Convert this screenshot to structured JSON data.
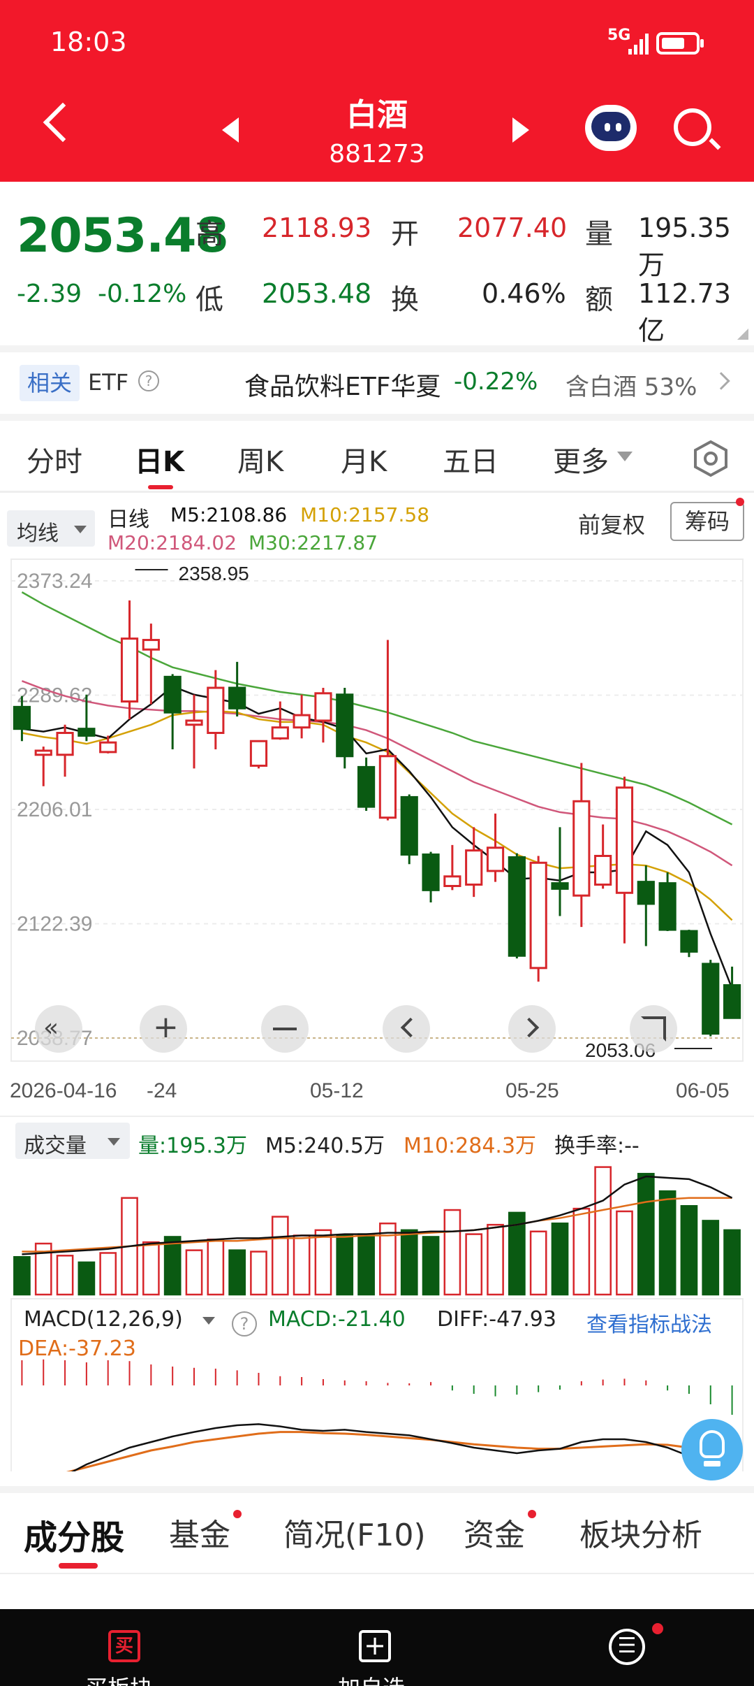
{
  "status_bar": {
    "time": "18:03",
    "network": "5G"
  },
  "header": {
    "title": "白酒",
    "code": "881273"
  },
  "quote": {
    "price": "2053.48",
    "change": "-2.39",
    "change_pct": "-0.12%",
    "high_label": "高",
    "high": "2118.93",
    "open_label": "开",
    "open": "2077.40",
    "volume_label": "量",
    "volume": "195.35万",
    "low_label": "低",
    "low": "2053.48",
    "turnover_label": "换",
    "turnover": "0.46%",
    "amount_label": "额",
    "amount": "112.73亿"
  },
  "etf": {
    "tag": "相关",
    "label": "ETF",
    "name": "食品饮料ETF华夏",
    "change": "-0.22%",
    "holding": "含白酒 53%"
  },
  "period_tabs": [
    "分时",
    "日K",
    "周K",
    "月K",
    "五日",
    "更多"
  ],
  "active_tab": "日K",
  "ma": {
    "selector": "均线",
    "line_label": "日线",
    "m5": "M5:2108.86",
    "m10": "M10:2157.58",
    "m20": "M20:2184.02",
    "m30": "M30:2217.87",
    "adjust": "前复权",
    "chips": "筹码"
  },
  "kline": {
    "y_ticks": [
      "2373.24",
      "2289.62",
      "2206.01",
      "2122.39",
      "2038.77"
    ],
    "max_label": "2358.95",
    "min_label": "2053.06",
    "x_labels": [
      "2026-04-16",
      "-24",
      "05-12",
      "05-25",
      "06-05"
    ]
  },
  "volume_panel": {
    "selector": "成交量",
    "vol": "量:195.3万",
    "m5": "M5:240.5万",
    "m10": "M10:284.3万",
    "turnover": "换手率:--"
  },
  "macd_panel": {
    "selector": "MACD(12,26,9)",
    "macd": "MACD:-21.40",
    "diff": "DIFF:-47.93",
    "link": "查看指标战法",
    "dea": "DEA:-37.23"
  },
  "bottom_tabs": [
    "成分股",
    "基金",
    "简况(F10)",
    "资金",
    "板块分析"
  ],
  "nav": [
    "买板块",
    "加自选",
    "更多"
  ],
  "colors": {
    "up": "#d7262b",
    "down": "#0a5a12",
    "brand": "#f2182a",
    "m5": "#111111",
    "m10": "#d4a106",
    "m20": "#d0577a",
    "m30": "#4aa63a"
  },
  "chart_data": {
    "type": "candlestick",
    "price_axis": [
      2038.77,
      2373.24
    ],
    "candles": [
      {
        "open": 2281,
        "close": 2265,
        "high": 2289,
        "low": 2256
      },
      {
        "open": 2246,
        "close": 2249,
        "high": 2252,
        "low": 2223
      },
      {
        "open": 2246,
        "close": 2262,
        "high": 2268,
        "low": 2230
      },
      {
        "open": 2265,
        "close": 2260,
        "high": 2290,
        "low": 2256
      },
      {
        "open": 2248,
        "close": 2255,
        "high": 2260,
        "low": 2247
      },
      {
        "open": 2285,
        "close": 2331,
        "high": 2358.95,
        "low": 2272
      },
      {
        "open": 2323,
        "close": 2330,
        "high": 2342,
        "low": 2283
      },
      {
        "open": 2303,
        "close": 2277,
        "high": 2305,
        "low": 2250
      },
      {
        "open": 2268,
        "close": 2271,
        "high": 2290,
        "low": 2236
      },
      {
        "open": 2262,
        "close": 2295,
        "high": 2308,
        "low": 2250
      },
      {
        "open": 2295,
        "close": 2280,
        "high": 2314,
        "low": 2274
      },
      {
        "open": 2238,
        "close": 2256,
        "high": 2256,
        "low": 2236
      },
      {
        "open": 2258,
        "close": 2266,
        "high": 2285,
        "low": 2257
      },
      {
        "open": 2266,
        "close": 2275,
        "high": 2290,
        "low": 2258
      },
      {
        "open": 2271,
        "close": 2291,
        "high": 2295,
        "low": 2255
      },
      {
        "open": 2290,
        "close": 2245,
        "high": 2295,
        "low": 2236
      },
      {
        "open": 2237,
        "close": 2208,
        "high": 2244,
        "low": 2205
      },
      {
        "open": 2200,
        "close": 2245,
        "high": 2330,
        "low": 2198
      },
      {
        "open": 2215,
        "close": 2173,
        "high": 2217,
        "low": 2166
      },
      {
        "open": 2173,
        "close": 2147,
        "high": 2175,
        "low": 2138
      },
      {
        "open": 2150,
        "close": 2157,
        "high": 2180,
        "low": 2147
      },
      {
        "open": 2151,
        "close": 2176,
        "high": 2193,
        "low": 2142
      },
      {
        "open": 2161,
        "close": 2178,
        "high": 2203,
        "low": 2153
      },
      {
        "open": 2171,
        "close": 2099,
        "high": 2174,
        "low": 2097
      },
      {
        "open": 2090,
        "close": 2167,
        "high": 2172,
        "low": 2080
      },
      {
        "open": 2152,
        "close": 2148,
        "high": 2193,
        "low": 2128
      },
      {
        "open": 2143,
        "close": 2212,
        "high": 2240,
        "low": 2120
      },
      {
        "open": 2151,
        "close": 2172,
        "high": 2195,
        "low": 2148
      },
      {
        "open": 2145,
        "close": 2222,
        "high": 2230,
        "low": 2108
      },
      {
        "open": 2153,
        "close": 2137,
        "high": 2165,
        "low": 2106
      },
      {
        "open": 2152,
        "close": 2118,
        "high": 2160,
        "low": 2117
      },
      {
        "open": 2117,
        "close": 2102,
        "high": 2118,
        "low": 2098
      },
      {
        "open": 2093,
        "close": 2042,
        "high": 2096,
        "low": 2040
      },
      {
        "open": 2077.4,
        "close": 2053.48,
        "high": 2091,
        "low": 2053.48
      }
    ],
    "ma5": [
      2265,
      2263,
      2266,
      2262,
      2258,
      2272,
      2283,
      2296,
      2290,
      2287,
      2284,
      2276,
      2280,
      2273,
      2270,
      2265,
      2247,
      2250,
      2234,
      2215,
      2193,
      2180,
      2168,
      2155,
      2156,
      2154,
      2160,
      2160,
      2162,
      2190,
      2180,
      2160,
      2115,
      2075
    ],
    "ma10": [
      2262,
      2259,
      2257,
      2254,
      2258,
      2263,
      2268,
      2275,
      2277,
      2278,
      2277,
      2272,
      2270,
      2270,
      2268,
      2260,
      2255,
      2248,
      2233,
      2218,
      2203,
      2192,
      2183,
      2173,
      2167,
      2163,
      2164,
      2165,
      2166,
      2165,
      2160,
      2152,
      2140,
      2125
    ],
    "ma20": [
      2300,
      2294,
      2289,
      2285,
      2282,
      2280,
      2279,
      2278,
      2278,
      2277,
      2276,
      2274,
      2272,
      2271,
      2270,
      2268,
      2264,
      2258,
      2250,
      2242,
      2234,
      2226,
      2220,
      2214,
      2208,
      2204,
      2202,
      2200,
      2199,
      2195,
      2190,
      2183,
      2175,
      2165
    ],
    "ma30": [
      2365,
      2356,
      2348,
      2340,
      2332,
      2325,
      2317,
      2310,
      2306,
      2302,
      2298,
      2295,
      2292,
      2290,
      2288,
      2285,
      2281,
      2277,
      2272,
      2267,
      2262,
      2256,
      2252,
      2248,
      2244,
      2240,
      2236,
      2232,
      2228,
      2224,
      2218,
      2211,
      2203,
      2195
    ],
    "volume": [
      0.28,
      0.38,
      0.29,
      0.24,
      0.31,
      0.72,
      0.39,
      0.43,
      0.33,
      0.41,
      0.33,
      0.32,
      0.58,
      0.44,
      0.48,
      0.44,
      0.45,
      0.53,
      0.48,
      0.43,
      0.63,
      0.45,
      0.52,
      0.61,
      0.47,
      0.53,
      0.64,
      0.95,
      0.62,
      0.9,
      0.77,
      0.66,
      0.55,
      0.48
    ],
    "vol_m5": [
      0.3,
      0.31,
      0.32,
      0.33,
      0.34,
      0.36,
      0.38,
      0.39,
      0.4,
      0.41,
      0.42,
      0.42,
      0.43,
      0.44,
      0.44,
      0.45,
      0.45,
      0.46,
      0.46,
      0.47,
      0.47,
      0.48,
      0.5,
      0.52,
      0.55,
      0.59,
      0.64,
      0.7,
      0.82,
      0.88,
      0.87,
      0.86,
      0.8,
      0.72
    ],
    "vol_m10": [
      0.32,
      0.32,
      0.33,
      0.34,
      0.35,
      0.36,
      0.37,
      0.38,
      0.39,
      0.4,
      0.4,
      0.41,
      0.42,
      0.42,
      0.43,
      0.43,
      0.44,
      0.44,
      0.45,
      0.46,
      0.47,
      0.48,
      0.5,
      0.52,
      0.55,
      0.57,
      0.6,
      0.63,
      0.66,
      0.69,
      0.71,
      0.72,
      0.72,
      0.72
    ],
    "macd_bars": [
      0.6,
      0.62,
      0.6,
      0.55,
      0.6,
      0.58,
      0.5,
      0.45,
      0.42,
      0.4,
      0.36,
      0.3,
      0.22,
      0.2,
      0.15,
      0.12,
      0.1,
      0.06,
      0.05,
      0.08,
      -0.12,
      -0.2,
      -0.26,
      -0.22,
      -0.16,
      -0.1,
      0.1,
      0.14,
      0.16,
      0.12,
      -0.12,
      -0.2,
      -0.45,
      -0.7
    ],
    "dif": [
      -0.9,
      -0.88,
      -0.7,
      -0.5,
      -0.35,
      -0.2,
      -0.1,
      0.0,
      0.08,
      0.15,
      0.2,
      0.22,
      0.18,
      0.12,
      0.1,
      0.12,
      0.08,
      0.05,
      0.02,
      -0.05,
      -0.12,
      -0.2,
      -0.25,
      -0.3,
      -0.25,
      -0.22,
      -0.1,
      -0.05,
      -0.05,
      -0.1,
      -0.2,
      -0.35,
      -0.55,
      -0.75
    ],
    "dea": [
      -0.8,
      -0.75,
      -0.65,
      -0.55,
      -0.45,
      -0.35,
      -0.25,
      -0.18,
      -0.1,
      -0.05,
      0.0,
      0.05,
      0.08,
      0.08,
      0.06,
      0.05,
      0.03,
      0.0,
      -0.03,
      -0.06,
      -0.1,
      -0.14,
      -0.17,
      -0.2,
      -0.22,
      -0.22,
      -0.2,
      -0.18,
      -0.16,
      -0.14,
      -0.15,
      -0.2,
      -0.28,
      -0.38
    ]
  }
}
